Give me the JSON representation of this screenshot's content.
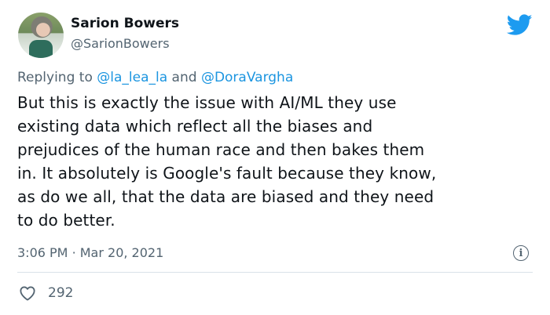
{
  "author": {
    "name": "Sarion Bowers",
    "handle": "@SarionBowers"
  },
  "reply": {
    "prefix": "Replying to",
    "user1": "@la_lea_la",
    "conjunction": "and",
    "user2": "@DoraVargha"
  },
  "tweet": {
    "line1": "But this is exactly the issue with AI/ML they use",
    "line2": "existing data which reflect all the biases and",
    "line3": "prejudices of the human race and then bakes them",
    "line4": "in. It absolutely is Google's fault because they know,",
    "line5": "as do we all, that the data are biased and they need",
    "line6": "to do better."
  },
  "meta": {
    "time": "3:06 PM",
    "separator": "·",
    "date": "Mar 20, 2021",
    "info_icon_glyph": "i"
  },
  "engagement": {
    "likes": "292"
  },
  "colors": {
    "accent": "#1b95e0",
    "muted": "#536471",
    "text": "#0f1419"
  },
  "icons": {
    "brand": "twitter-bird-icon",
    "info": "info-icon",
    "like": "heart-icon"
  }
}
